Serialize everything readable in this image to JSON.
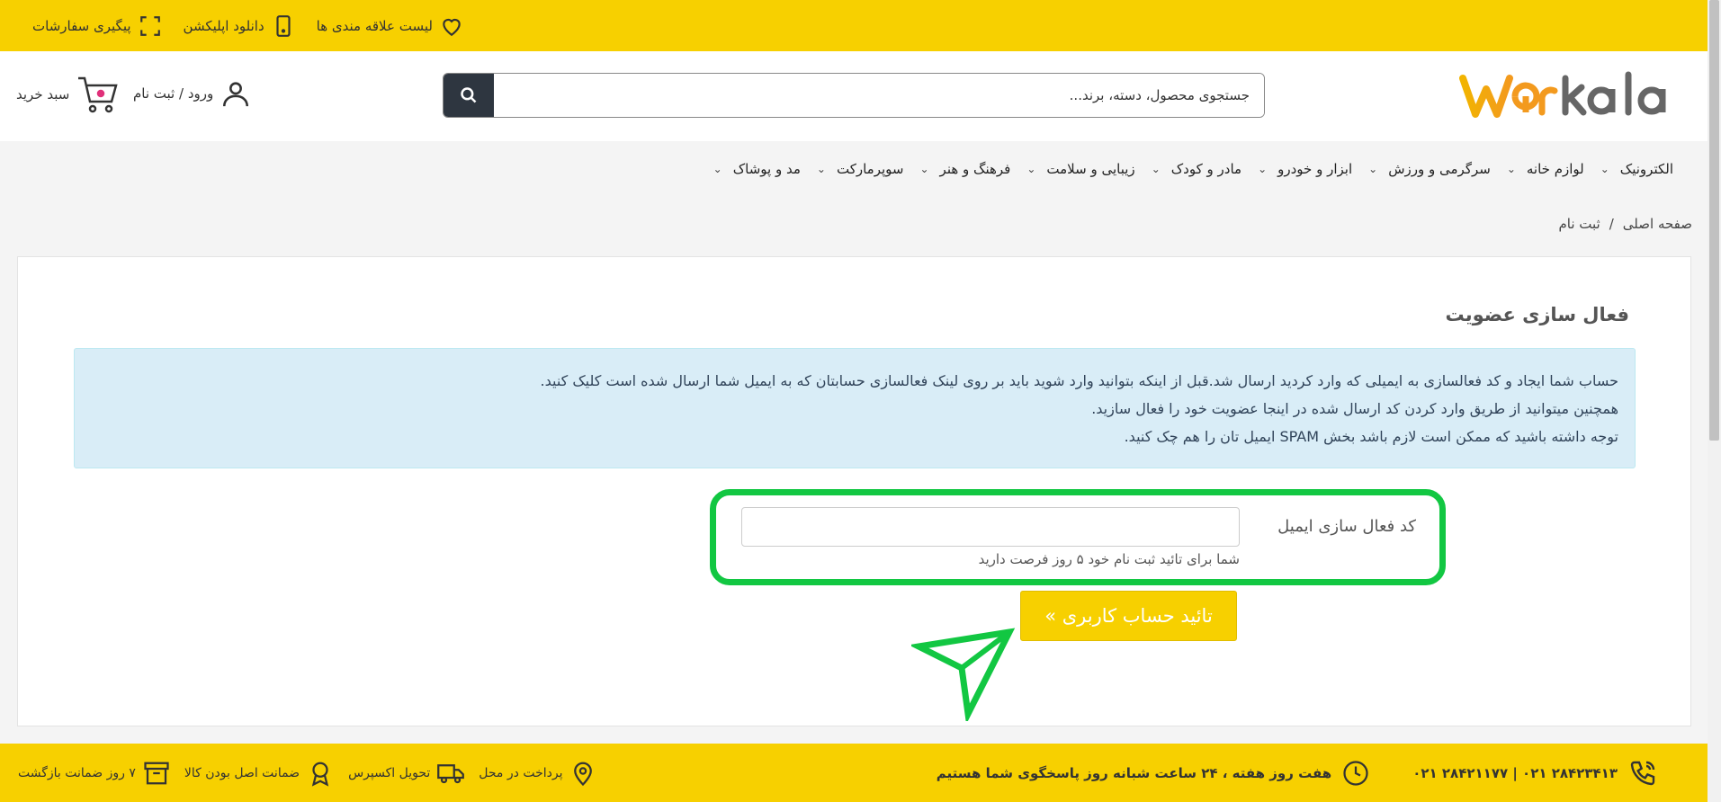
{
  "topbar": {
    "wishlist_label": "لیست علاقه مندی ها",
    "download_app_label": "دانلود اپلیکشن",
    "track_orders_label": "پیگیری سفارشات"
  },
  "header": {
    "logo_text": "Warkala",
    "search": {
      "placeholder": "جستجوی محصول، دسته، برند..."
    },
    "login_label": "ورود / ثبت نام",
    "cart_label": "سبد خرید"
  },
  "nav": {
    "items": [
      {
        "label": "الکترونیک"
      },
      {
        "label": "لوازم خانه"
      },
      {
        "label": "سرگرمی و ورزش"
      },
      {
        "label": "ابزار و خودرو"
      },
      {
        "label": "مادر و کودک"
      },
      {
        "label": "زیبایی و سلامت"
      },
      {
        "label": "فرهنگ و هنر"
      },
      {
        "label": "سوپرمارکت"
      },
      {
        "label": "مد و پوشاک"
      }
    ]
  },
  "breadcrumb": {
    "home": "صفحه اصلی",
    "separator": "/",
    "current": "ثبت نام"
  },
  "main": {
    "title": "فعال سازی عضویت",
    "alert_lines": [
      "حساب شما ایجاد و کد فعالسازی به ایمیلی که وارد کردید ارسال شد.قبل از اینکه بتوانید وارد شوید باید بر روی لینک فعالسازی حسابتان که به ایمیل شما ارسال شده است کلیک کنید.",
      "همچنین میتوانید از طریق وارد کردن کد ارسال شده در اینجا عضویت خود را فعال سازید.",
      "توجه داشته باشید که ممکن است لازم باشد بخش SPAM ایمیل تان را هم چک کنید."
    ],
    "form": {
      "label": "کد فعال سازی ایمیل",
      "input_value": "",
      "hint": "شما برای تائید ثبت نام خود ۵ روز فرصت دارید"
    },
    "submit_label": "تائید حساب کاربری »"
  },
  "footer": {
    "phone": "۰۲۱ ۲۸۴۲۱۱۷۷ | ۰۲۱ ۲۸۴۲۳۴۱۳",
    "hours": "هفت روز هفته ، ۲۴ ساعت شبانه روز پاسخگوی شما هستیم",
    "features": [
      {
        "label": "پرداخت در محل"
      },
      {
        "label": "تحویل اکسپرس"
      },
      {
        "label": "ضمانت اصل بودن کالا"
      },
      {
        "label": "۷ روز ضمانت بازگشت"
      }
    ]
  },
  "colors": {
    "brand_yellow": "#f7d000",
    "highlight_green": "#12c742",
    "search_button": "#2e3640",
    "alert_bg": "#d9edf7"
  }
}
